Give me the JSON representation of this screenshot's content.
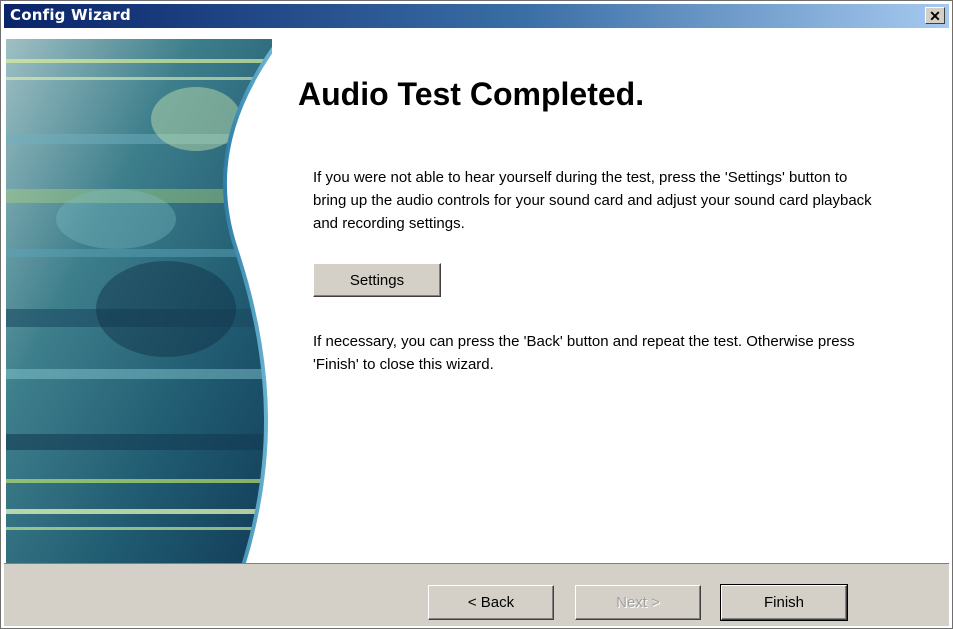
{
  "window": {
    "title": "Config Wizard",
    "close_glyph": "✕"
  },
  "main": {
    "heading": "Audio Test Completed.",
    "paragraph1": "If you were not able to hear yourself during the test, press the 'Settings' button to bring up the audio controls for your sound card and adjust your sound card playback and recording settings.",
    "settings_label": "Settings",
    "paragraph2": "If necessary, you can press the 'Back' button and repeat the test. Otherwise press 'Finish' to close this wizard."
  },
  "footer": {
    "back_label": "< Back",
    "next_label": "Next >",
    "finish_label": "Finish"
  },
  "colors": {
    "titlebar_start": "#0a246a",
    "titlebar_end": "#a6caf0",
    "button_face": "#d4d0c8",
    "disabled_text": "#a0a0a0"
  },
  "icons": {
    "close": "close-icon"
  }
}
